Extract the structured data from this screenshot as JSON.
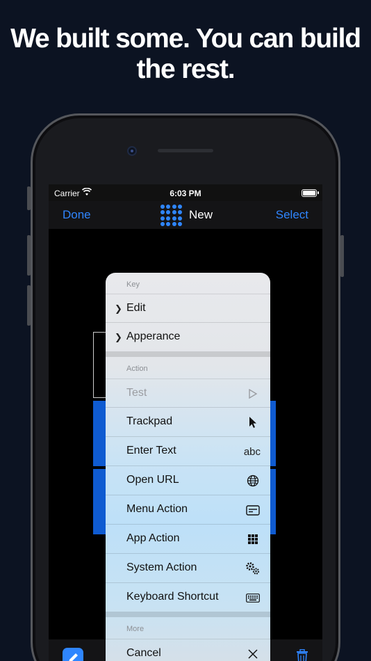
{
  "headline": {
    "line1": "We built some. You can build",
    "line2": "the rest."
  },
  "status_bar": {
    "carrier": "Carrier",
    "time": "6:03 PM"
  },
  "nav": {
    "left": "Done",
    "title": "New",
    "right": "Select"
  },
  "menu": {
    "key_header": "Key",
    "key_items": [
      "Edit",
      "Apperance"
    ],
    "action_header": "Action",
    "action_items": [
      {
        "label": "Test",
        "icon": "play-icon",
        "disabled": true
      },
      {
        "label": "Trackpad",
        "icon": "cursor-icon"
      },
      {
        "label": "Enter Text",
        "icon_text": "abc"
      },
      {
        "label": "Open URL",
        "icon": "globe-icon"
      },
      {
        "label": "Menu Action",
        "icon": "menu-card-icon"
      },
      {
        "label": "App Action",
        "icon": "grid-icon"
      },
      {
        "label": "System Action",
        "icon": "gears-icon"
      },
      {
        "label": "Keyboard Shortcut",
        "icon": "keyboard-icon"
      }
    ],
    "more_header": "More",
    "cancel": "Cancel"
  },
  "colors": {
    "accent": "#2f86ff",
    "background": "#0c1322",
    "key_blue": "#0f5bd1"
  }
}
